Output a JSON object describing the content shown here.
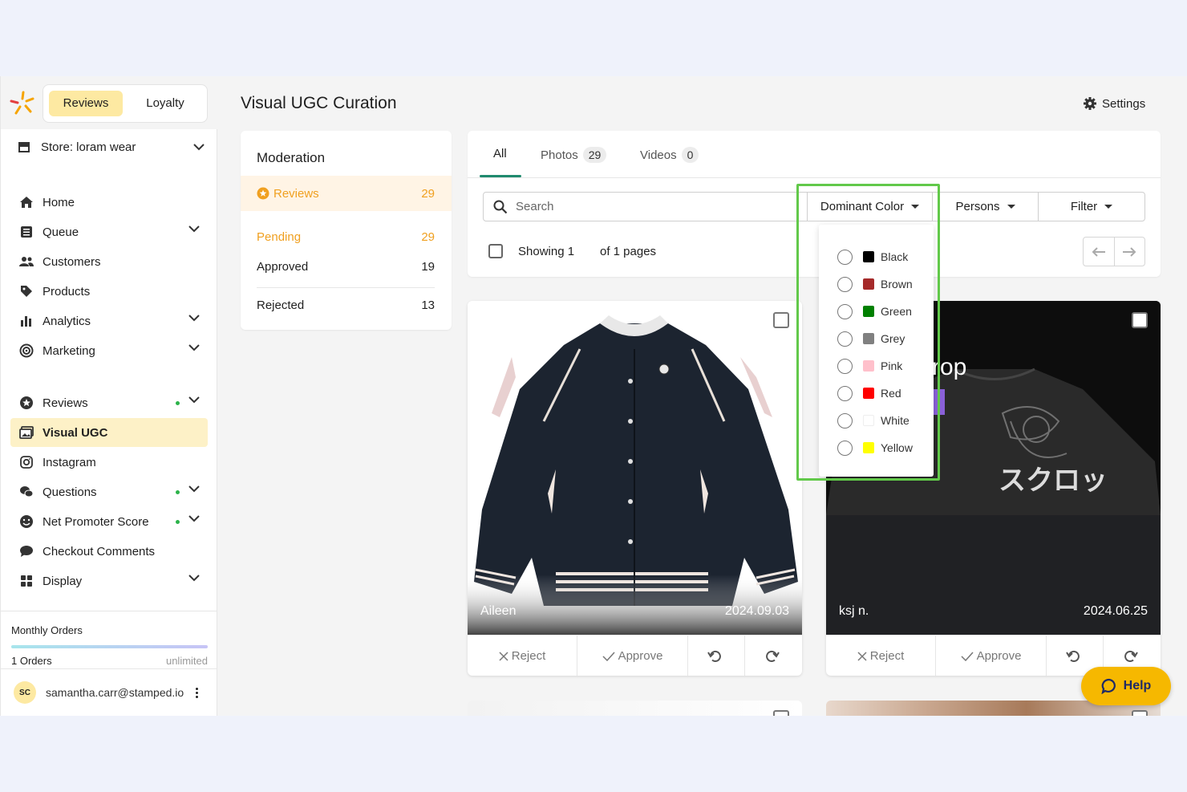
{
  "switcher": {
    "reviews": "Reviews",
    "loyalty": "Loyalty"
  },
  "store": {
    "label": "Store: loram wear"
  },
  "nav": [
    {
      "label": "Home",
      "icon": "home-icon"
    },
    {
      "label": "Queue",
      "icon": "queue-icon"
    },
    {
      "label": "Customers",
      "icon": "customers-icon"
    },
    {
      "label": "Products",
      "icon": "tag-icon"
    },
    {
      "label": "Analytics",
      "icon": "bar-chart-icon"
    },
    {
      "label": "Marketing",
      "icon": "target-icon"
    },
    {
      "label": "Reviews",
      "icon": "star-icon"
    },
    {
      "label": "Visual UGC",
      "icon": "gallery-icon"
    },
    {
      "label": "Instagram",
      "icon": "instagram-icon"
    },
    {
      "label": "Questions",
      "icon": "questions-icon"
    },
    {
      "label": "Net Promoter Score",
      "icon": "smile-icon"
    },
    {
      "label": "Checkout Comments",
      "icon": "comment-icon"
    },
    {
      "label": "Display",
      "icon": "grid-icon"
    }
  ],
  "orders": {
    "title": "Monthly Orders",
    "count": "1 Orders",
    "limit": "unlimited"
  },
  "user": {
    "initials": "SC",
    "email": "samantha.carr@stamped.io"
  },
  "header": {
    "title": "Visual UGC Curation",
    "settings": "Settings"
  },
  "moderation": {
    "title": "Moderation",
    "reviews": {
      "label": "Reviews",
      "count": "29"
    },
    "pending": {
      "label": "Pending",
      "count": "29"
    },
    "approved": {
      "label": "Approved",
      "count": "19"
    },
    "rejected": {
      "label": "Rejected",
      "count": "13"
    }
  },
  "tabs": {
    "all": "All",
    "photos": {
      "label": "Photos",
      "count": "29"
    },
    "videos": {
      "label": "Videos",
      "count": "0"
    }
  },
  "toolbar": {
    "search_placeholder": "Search",
    "dominant_color": "Dominant Color",
    "persons": "Persons",
    "filter": "Filter",
    "showing": "Showing 1",
    "of_pages": "of 1 pages"
  },
  "color_options": [
    {
      "label": "Black",
      "color": "#000000"
    },
    {
      "label": "Brown",
      "color": "#a52a2a"
    },
    {
      "label": "Green",
      "color": "#008000"
    },
    {
      "label": "Grey",
      "color": "#808080"
    },
    {
      "label": "Pink",
      "color": "#ffc0cb"
    },
    {
      "label": "Red",
      "color": "#ff0000"
    },
    {
      "label": "White",
      "color": "#ffffff"
    },
    {
      "label": "Yellow",
      "color": "#ffff00"
    }
  ],
  "cards": [
    {
      "author": "Aileen",
      "date": "2024.09.03",
      "reject": "Reject",
      "approve": "Approve"
    },
    {
      "author": "ksj n.",
      "date": "2024.06.25",
      "reject": "Reject",
      "approve": "Approve",
      "overlay_text": "rop",
      "shirt_text": "スクロッ"
    }
  ],
  "help": {
    "label": "Help"
  },
  "colors": {
    "accent_yellow": "#fde9a2",
    "pending_orange": "#f0a020",
    "highlight_green": "#62c94a",
    "tab_green": "#1f8a6e"
  }
}
